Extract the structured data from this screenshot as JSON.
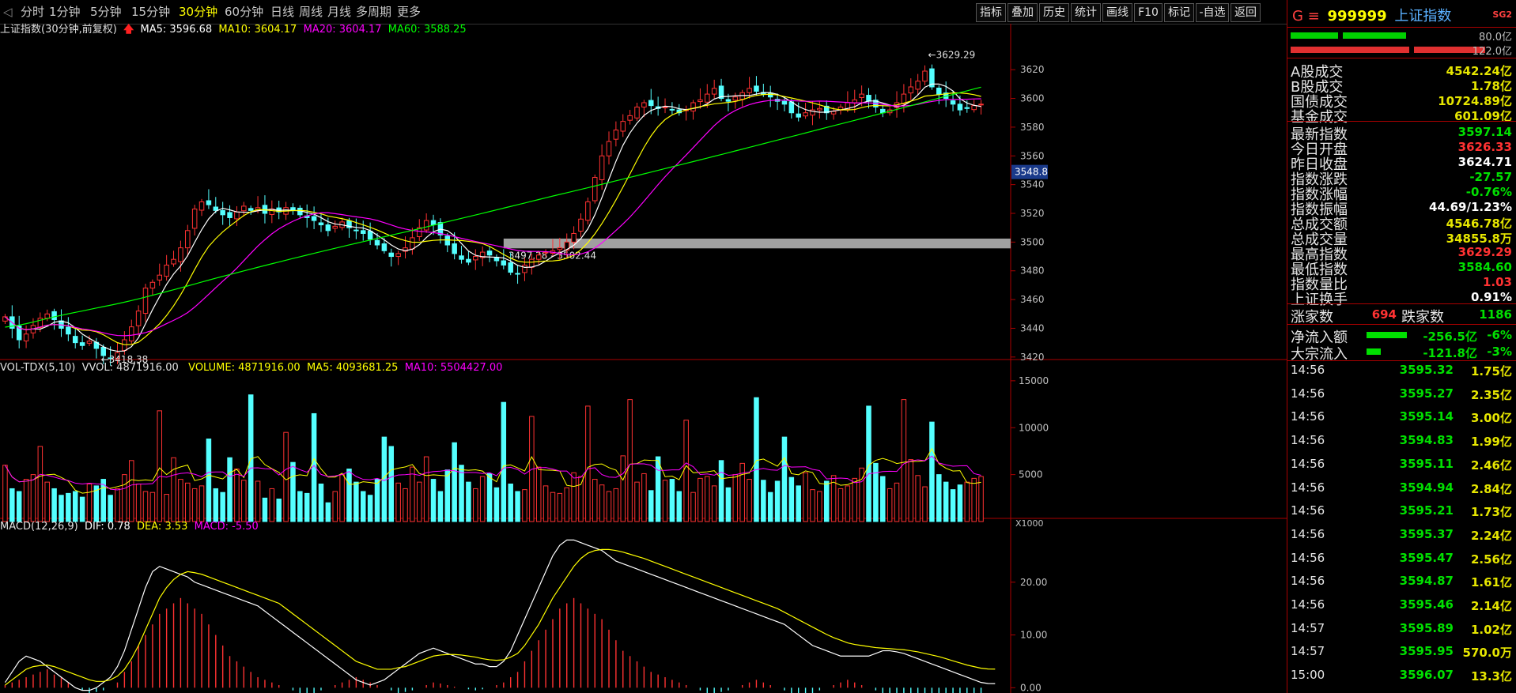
{
  "toolbar": {
    "periods": [
      "分时",
      "1分钟",
      "5分钟",
      "15分钟",
      "30分钟",
      "60分钟",
      "日线",
      "周线",
      "月线",
      "多周期",
      "更多"
    ],
    "active_period": "30分钟",
    "tools": [
      "指标",
      "叠加",
      "历史",
      "统计",
      "画线",
      "F10",
      "标记",
      "-自选",
      "返回"
    ]
  },
  "main_legend": {
    "title": "上证指数(30分钟,前复权)",
    "ma5": "MA5: 3596.68",
    "ma10": "MA10: 3604.17",
    "ma20": "MA20: 3604.17",
    "ma60": "MA60: 3588.25"
  },
  "vol_legend": {
    "name": "VOL-TDX(5,10)",
    "vvol": "VVOL: 4871916.00",
    "volume": "VOLUME: 4871916.00",
    "ma5": "MA5: 4093681.25",
    "ma10": "MA10: 5504427.00"
  },
  "macd_legend": {
    "name": "MACD(12,26,9)",
    "dif": "DIF: 0.78",
    "dea": "DEA: 3.53",
    "macd": "MACD: -5.50"
  },
  "annotations": {
    "high": "3629.29",
    "low": "3418.38",
    "range": "3497.28 - 3502.44",
    "crosshair_price": "3548.8",
    "vol_unit": "X1000"
  },
  "colors": {
    "up": "#ff3232",
    "down": "#54ffff",
    "ma5": "#ffffff",
    "ma10": "#ffff00",
    "ma20": "#ff00ff",
    "ma60": "#00ff00"
  },
  "chart_data": {
    "type": "candlestick",
    "price_axis": {
      "ylim": [
        3410,
        3630
      ],
      "ticks": [
        3420,
        3440,
        3460,
        3480,
        3500,
        3520,
        3540,
        3560,
        3580,
        3600,
        3620
      ]
    },
    "volume_axis": {
      "ylim": [
        0,
        16000
      ],
      "ticks": [
        5000,
        10000,
        15000
      ],
      "unit": "X1000"
    },
    "macd_axis": {
      "ylim": [
        -1,
        30
      ],
      "ticks": [
        0.0,
        10.0,
        20.0
      ]
    },
    "close": [
      3448,
      3440,
      3432,
      3436,
      3442,
      3447,
      3450,
      3446,
      3440,
      3436,
      3430,
      3428,
      3431,
      3426,
      3421,
      3419,
      3423,
      3432,
      3441,
      3452,
      3468,
      3472,
      3477,
      3484,
      3488,
      3496,
      3508,
      3523,
      3528,
      3526,
      3522,
      3519,
      3517,
      3521,
      3525,
      3522,
      3524,
      3520,
      3523,
      3521,
      3524,
      3522,
      3519,
      3517,
      3515,
      3512,
      3508,
      3511,
      3514,
      3510,
      3508,
      3506,
      3502,
      3498,
      3494,
      3490,
      3492,
      3496,
      3503,
      3510,
      3515,
      3512,
      3505,
      3498,
      3492,
      3488,
      3486,
      3490,
      3493,
      3491,
      3487,
      3484,
      3479,
      3478,
      3484,
      3488,
      3491,
      3493,
      3494,
      3496,
      3500,
      3506,
      3516,
      3528,
      3545,
      3560,
      3570,
      3578,
      3584,
      3588,
      3594,
      3597,
      3595,
      3593,
      3594,
      3592,
      3590,
      3592,
      3597,
      3599,
      3603,
      3607,
      3600,
      3598,
      3601,
      3604,
      3607,
      3605,
      3603,
      3601,
      3598,
      3596,
      3590,
      3587,
      3590,
      3592,
      3593,
      3590,
      3591,
      3594,
      3597,
      3599,
      3603,
      3598,
      3594,
      3590,
      3592,
      3597,
      3603,
      3608,
      3612,
      3619,
      3608,
      3603,
      3600,
      3596,
      3592,
      3593,
      3595,
      3596
    ],
    "volume": [
      6000,
      3500,
      3200,
      4500,
      5000,
      8000,
      4200,
      3500,
      2800,
      3000,
      3200,
      2600,
      4000,
      3800,
      4500,
      2800,
      3500,
      5000,
      6500,
      4000,
      3200,
      3100,
      11800,
      2900,
      6800,
      4500,
      4100,
      3500,
      3800,
      8800,
      3500,
      3100,
      6800,
      5600,
      4400,
      13500,
      4300,
      2500,
      3500,
      2400,
      9500,
      6300,
      3200,
      3000,
      11500,
      4000,
      2000,
      3200,
      5000,
      5600,
      4200,
      3200,
      2800,
      4500,
      9000,
      8000,
      4100,
      3500,
      5800,
      4200,
      6900,
      4500,
      3200,
      5500,
      8400,
      6000,
      4200,
      3500,
      4800,
      5100,
      3600,
      12700,
      4000,
      3200,
      3400,
      11200,
      5800,
      3800,
      3100,
      3000,
      3600,
      5200,
      4800,
      12300,
      4500,
      3900,
      3200,
      3500,
      7000,
      13000,
      4200,
      5100,
      3300,
      6900,
      4400,
      4500,
      3200,
      10800,
      3100,
      4600,
      4800,
      3800,
      6500,
      3600,
      5000,
      6200,
      4500,
      13200,
      4400,
      3100,
      4300,
      9000,
      4700,
      3800,
      5200,
      3400,
      3200,
      4300,
      4900,
      3500,
      3800,
      4600,
      5700,
      12300,
      6200,
      4800,
      3500,
      4100,
      13000,
      6600,
      4900,
      3700,
      10600,
      5000,
      4200,
      3400,
      3900,
      4200,
      4600,
      4800
    ],
    "macd_hist": [
      0.5,
      1,
      1.5,
      2,
      2.5,
      3,
      3.5,
      2.5,
      2,
      1,
      0,
      -0.5,
      -1,
      -0.8,
      -0.5,
      0,
      1,
      3,
      5,
      8,
      10,
      12,
      14,
      15,
      16,
      17,
      16,
      15,
      14,
      12,
      10,
      8,
      6,
      5,
      4,
      3,
      2,
      1.5,
      1,
      0.5,
      0,
      -0.5,
      -1,
      -1.5,
      -1,
      -0.5,
      0,
      0.5,
      1,
      1.5,
      2,
      1.5,
      1,
      0.5,
      0,
      -0.5,
      -1,
      -0.8,
      -0.5,
      0,
      0.5,
      1,
      0.8,
      0.5,
      0.2,
      0,
      -0.3,
      -0.5,
      -0.3,
      0,
      0.5,
      1,
      2,
      3,
      5,
      7,
      9,
      11,
      13,
      15,
      16,
      17,
      16,
      15,
      14,
      13,
      11,
      9,
      7,
      6,
      5,
      4,
      3,
      2.5,
      2,
      1.5,
      1,
      0.5,
      0,
      -0.5,
      -1,
      -1,
      -0.8,
      -0.5,
      0,
      0.5,
      1,
      1.5,
      1,
      0.5,
      0,
      -0.5,
      -1,
      -1.5,
      -1.2,
      -1,
      -0.5,
      0,
      0.5,
      1,
      1.5,
      1,
      0.5,
      0,
      -0.5,
      -1,
      -1.5,
      -2,
      -2.5,
      -3,
      -3.5,
      -4,
      -4.5,
      -5,
      -5.5,
      -5,
      -5.5,
      -5.5,
      -5.5,
      -5.5
    ],
    "dif": [
      1,
      3,
      5,
      6,
      5.5,
      5,
      4,
      3,
      2,
      1,
      0,
      -0.5,
      -0.5,
      0,
      1,
      2,
      4,
      7,
      11,
      15,
      19,
      22,
      23,
      22.5,
      22,
      21.5,
      21,
      20,
      19.5,
      19,
      18.5,
      18,
      17.5,
      17,
      16.5,
      16,
      15.5,
      14.5,
      13.5,
      12.5,
      11.5,
      10.5,
      9.5,
      8.5,
      7.5,
      6.5,
      5.5,
      4.5,
      3.5,
      2.5,
      1.5,
      1,
      0.5,
      1,
      1.5,
      2.5,
      3.5,
      4.5,
      5.5,
      6.5,
      7,
      7.5,
      7,
      6.5,
      6,
      5.5,
      5,
      4.5,
      4.5,
      4,
      4,
      5,
      7,
      10,
      13,
      16,
      19,
      22,
      25,
      27,
      28,
      28,
      27.5,
      27,
      26.5,
      26,
      25,
      24,
      23.5,
      23,
      22.5,
      22,
      21.5,
      21,
      20.5,
      20,
      19.5,
      19,
      18.5,
      18,
      17.5,
      17,
      16.5,
      16,
      15.5,
      15,
      14.5,
      14,
      13.5,
      13,
      12.5,
      12,
      11,
      10,
      9,
      8,
      7.5,
      7,
      6.5,
      6,
      6,
      6,
      6,
      6,
      6.5,
      7,
      7,
      6.8,
      6.5,
      6,
      5.5,
      5,
      4.5,
      4,
      3.5,
      3,
      2.5,
      2,
      1.5,
      1,
      0.8,
      0.78
    ],
    "dea": [
      0.5,
      1.5,
      2.5,
      3.5,
      4,
      4.2,
      4.3,
      4,
      3.5,
      3,
      2.5,
      2,
      1.5,
      1.2,
      1.2,
      1.5,
      2.2,
      3.5,
      5.5,
      8,
      11,
      14,
      17,
      19,
      20.5,
      21.5,
      22,
      21.8,
      21.5,
      21,
      20.5,
      20,
      19.5,
      19,
      18.5,
      18,
      17.5,
      17,
      16.5,
      16,
      15,
      14,
      13,
      12,
      11,
      10,
      9,
      8,
      7,
      6,
      5,
      4.5,
      4,
      3.5,
      3.5,
      3.5,
      3.8,
      4,
      4.5,
      5,
      5.5,
      6,
      6.2,
      6.3,
      6.3,
      6.2,
      6,
      5.8,
      5.5,
      5.3,
      5.2,
      5.3,
      5.8,
      6.5,
      8,
      10,
      12,
      14.5,
      17,
      19,
      21,
      23,
      24.5,
      25.5,
      26,
      26.2,
      26.2,
      26,
      25.7,
      25.3,
      24.9,
      24.5,
      24,
      23.5,
      23,
      22.5,
      22,
      21.5,
      21,
      20.5,
      20,
      19.5,
      19,
      18.5,
      18,
      17.5,
      17,
      16.5,
      16,
      15.5,
      15,
      14.3,
      13.6,
      12.9,
      12.2,
      11.5,
      10.8,
      10.1,
      9.5,
      9,
      8.5,
      8.2,
      8,
      7.8,
      7.6,
      7.5,
      7.4,
      7.3,
      7.2,
      7,
      6.8,
      6.5,
      6.2,
      5.9,
      5.5,
      5.1,
      4.7,
      4.3,
      4,
      3.7,
      3.55,
      3.53
    ]
  },
  "quote_panel": {
    "title_prefix": "G ≡",
    "code": "999999",
    "name": "上证指数",
    "tag": "SG2",
    "bar1_val": "80.0亿",
    "bar2_val": "122.0亿",
    "turnover_rows": [
      {
        "label": "A股成交",
        "value": "4542.24亿"
      },
      {
        "label": "B股成交",
        "value": "1.78亿"
      },
      {
        "label": "国债成交",
        "value": "10724.89亿"
      },
      {
        "label": "基金成交",
        "value": "601.09亿"
      }
    ],
    "stat_rows": [
      {
        "label": "最新指数",
        "value": "3597.14",
        "color": "#00e000"
      },
      {
        "label": "今日开盘",
        "value": "3626.33",
        "color": "#ff3232"
      },
      {
        "label": "昨日收盘",
        "value": "3624.71",
        "color": "#ffffff"
      },
      {
        "label": "指数涨跌",
        "value": "-27.57",
        "color": "#00e000"
      },
      {
        "label": "指数涨幅",
        "value": "-0.76%",
        "color": "#00e000"
      },
      {
        "label": "指数振幅",
        "value": "44.69/1.23%",
        "color": "#ffffff"
      },
      {
        "label": "总成交额",
        "value": "4546.78亿",
        "color": "#e6e600"
      },
      {
        "label": "总成交量",
        "value": "34855.8万",
        "color": "#e6e600"
      },
      {
        "label": "最高指数",
        "value": "3629.29",
        "color": "#ff3232"
      },
      {
        "label": "最低指数",
        "value": "3584.60",
        "color": "#00e000"
      },
      {
        "label": "指数量比",
        "value": "1.03",
        "color": "#ff3232"
      },
      {
        "label": "上证换手",
        "value": "0.91%",
        "color": "#ffffff"
      }
    ],
    "breadth": {
      "up_label": "涨家数",
      "up_value": "694",
      "down_label": "跌家数",
      "down_value": "1186"
    },
    "flows": [
      {
        "label": "净流入额",
        "value": "-256.5亿",
        "pct": "-6%",
        "fill": 0.85
      },
      {
        "label": "大宗流入",
        "value": "-121.8亿",
        "pct": "-3%",
        "fill": 0.3
      }
    ],
    "ticks": [
      {
        "time": "14:56",
        "price": "3595.32",
        "vol": "1.75亿"
      },
      {
        "time": "14:56",
        "price": "3595.27",
        "vol": "2.35亿"
      },
      {
        "time": "14:56",
        "price": "3595.14",
        "vol": "3.00亿"
      },
      {
        "time": "14:56",
        "price": "3594.83",
        "vol": "1.99亿"
      },
      {
        "time": "14:56",
        "price": "3595.11",
        "vol": "2.46亿"
      },
      {
        "time": "14:56",
        "price": "3594.94",
        "vol": "2.84亿"
      },
      {
        "time": "14:56",
        "price": "3595.21",
        "vol": "1.73亿"
      },
      {
        "time": "14:56",
        "price": "3595.37",
        "vol": "2.24亿"
      },
      {
        "time": "14:56",
        "price": "3595.47",
        "vol": "2.56亿"
      },
      {
        "time": "14:56",
        "price": "3594.87",
        "vol": "1.61亿"
      },
      {
        "time": "14:56",
        "price": "3595.46",
        "vol": "2.14亿"
      },
      {
        "time": "14:57",
        "price": "3595.89",
        "vol": "1.02亿"
      },
      {
        "time": "14:57",
        "price": "3595.95",
        "vol": "570.0万"
      },
      {
        "time": "15:00",
        "price": "3596.07",
        "vol": "13.3亿"
      }
    ]
  }
}
